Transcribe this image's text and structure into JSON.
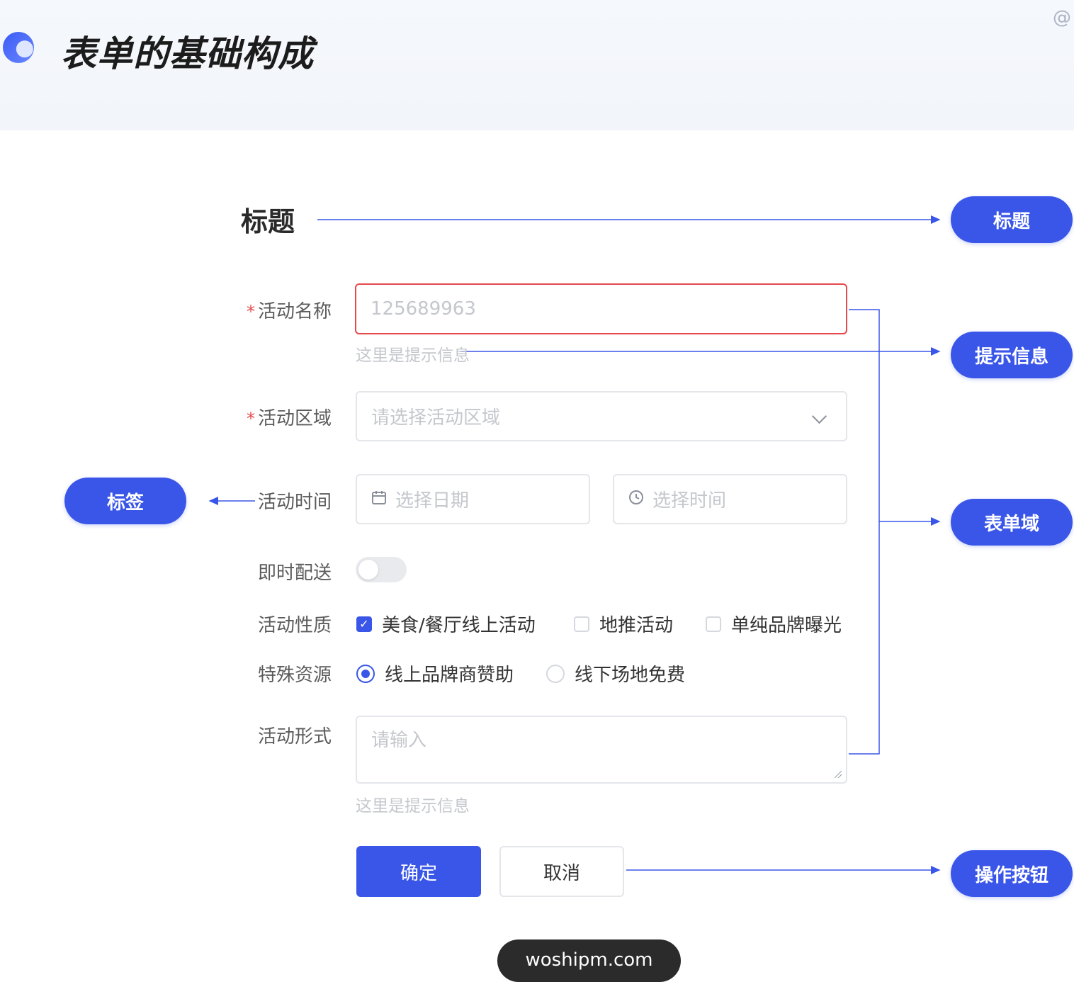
{
  "header": {
    "title": "表单的基础构成",
    "corner": "@"
  },
  "form": {
    "title": "标题",
    "fields": {
      "name": {
        "label": "活动名称",
        "required": "*",
        "value": "125689963",
        "hint": "这里是提示信息"
      },
      "region": {
        "label": "活动区域",
        "required": "*",
        "placeholder": "请选择活动区域"
      },
      "time": {
        "label": "活动时间",
        "date_placeholder": "选择日期",
        "time_placeholder": "选择时间",
        "date_icon": "calendar-icon",
        "time_icon": "clock-icon"
      },
      "delivery": {
        "label": "即时配送",
        "on": false
      },
      "nature": {
        "label": "活动性质",
        "options": [
          "美食/餐厅线上活动",
          "地推活动",
          "单纯品牌曝光"
        ],
        "checked": [
          true,
          false,
          false
        ]
      },
      "resource": {
        "label": "特殊资源",
        "options": [
          "线上品牌商赞助",
          "线下场地免费"
        ],
        "selected": "线上品牌商赞助"
      },
      "form_type": {
        "label": "活动形式",
        "placeholder": "请输入",
        "hint": "这里是提示信息"
      }
    },
    "buttons": {
      "confirm": "确定",
      "cancel": "取消"
    }
  },
  "annotations": {
    "title": "标题",
    "hint": "提示信息",
    "label": "标签",
    "field": "表单域",
    "action": "操作按钮"
  },
  "watermark": "woshipm.com",
  "colors": {
    "accent": "#3a56e8",
    "error": "#e5484d",
    "placeholder": "#c4c7cc"
  }
}
